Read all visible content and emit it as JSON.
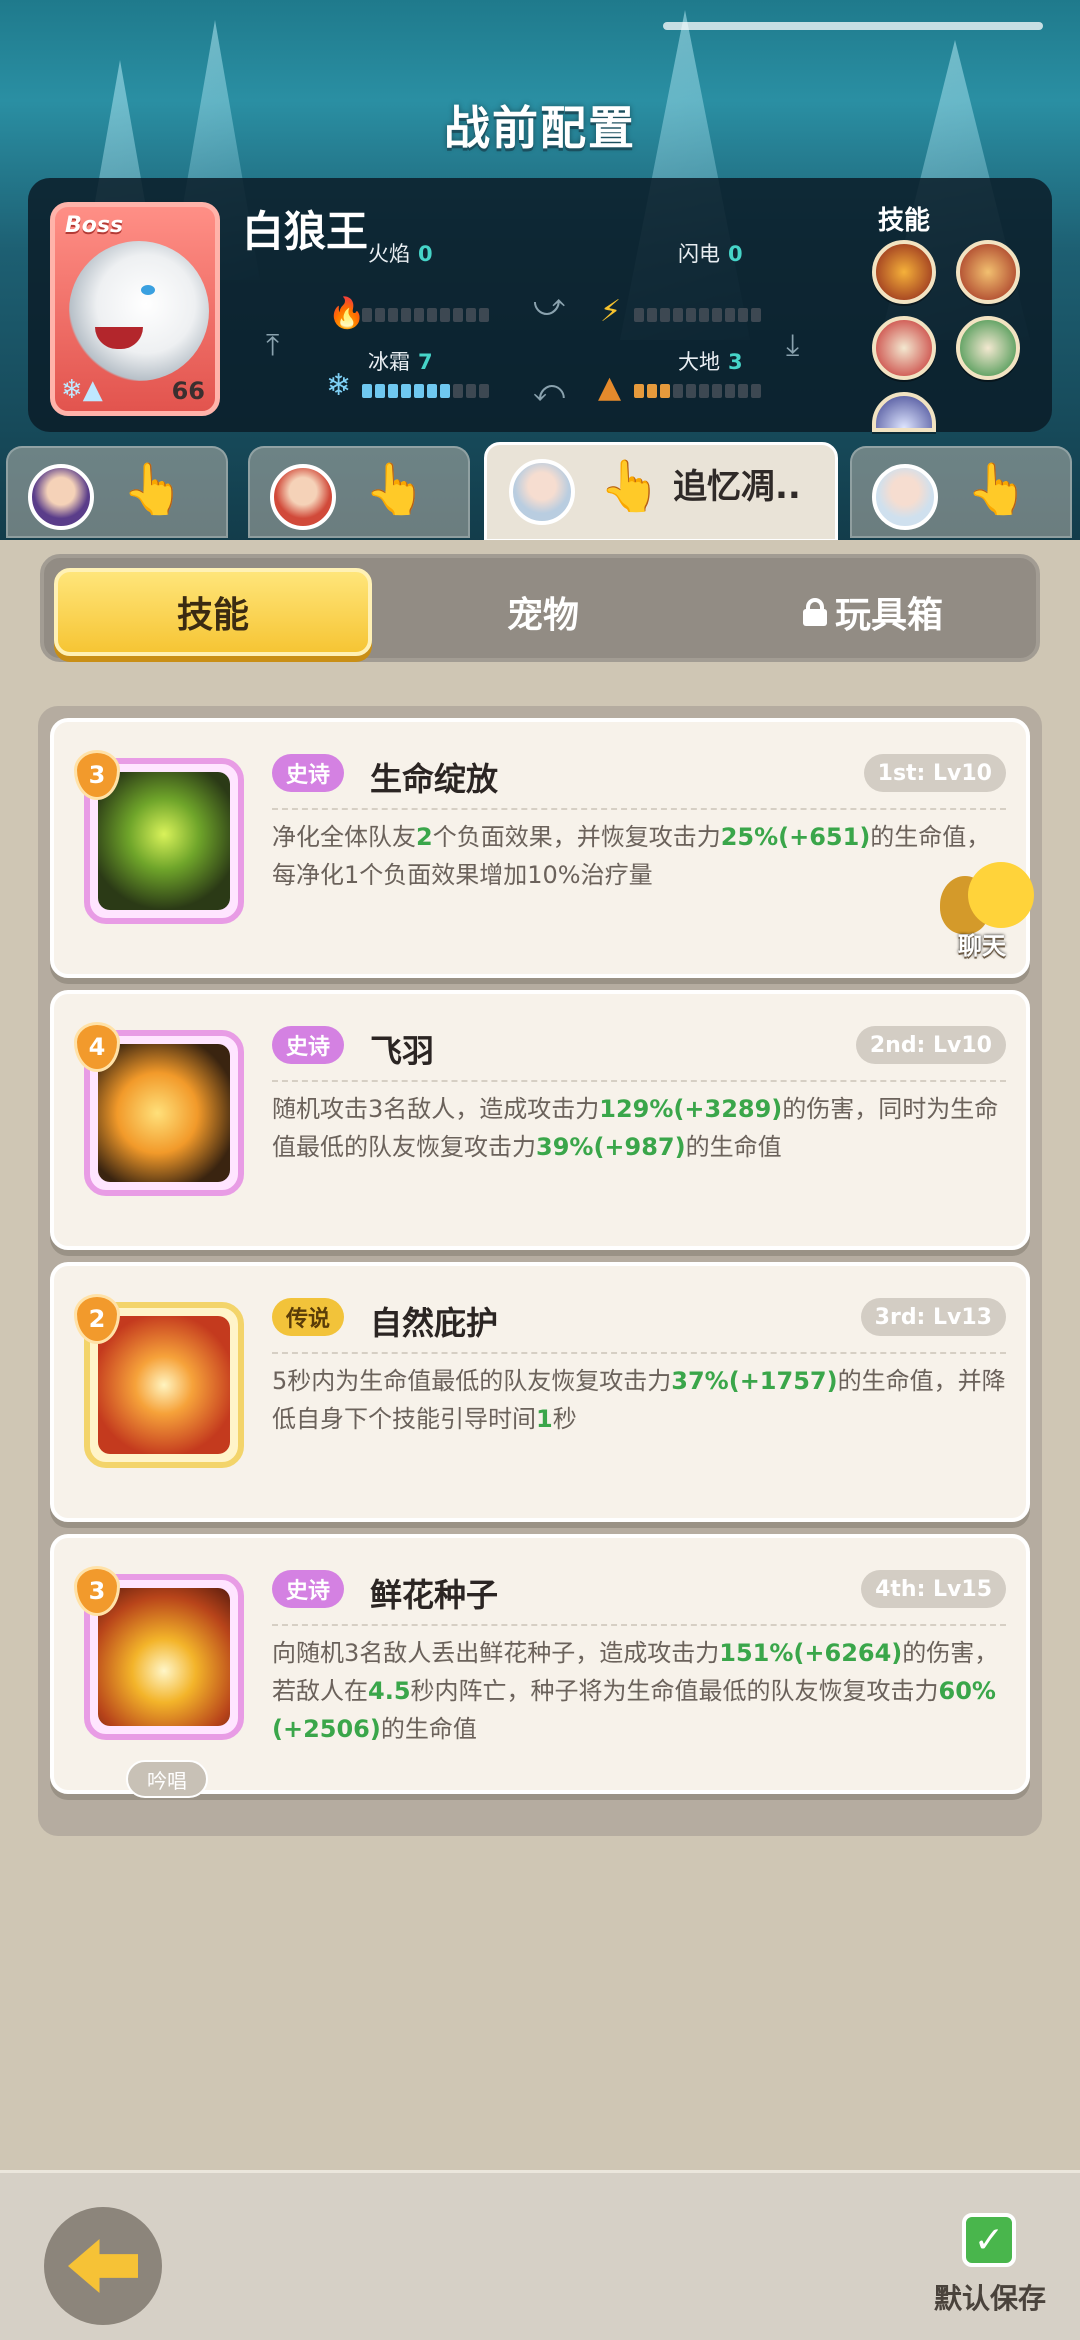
{
  "screen": {
    "title": "战前配置"
  },
  "boss": {
    "tag": "Boss",
    "name": "白狼王",
    "level": "66",
    "stats": {
      "fire": {
        "label": "火焰",
        "value": "0",
        "level_fraction": 0
      },
      "lightning": {
        "label": "闪电",
        "value": "0",
        "level_fraction": 0
      },
      "frost": {
        "label": "冰霜",
        "value": "7",
        "level_fraction": 0.7
      },
      "earth": {
        "label": "大地",
        "value": "3",
        "level_fraction": 0.3
      }
    },
    "skills_label": "技能",
    "skill_icons": [
      "claw-fire-icon",
      "claw-slash-icon",
      "red-beast-icon",
      "green-beast-icon",
      "moon-icon"
    ]
  },
  "hero_tabs": [
    {
      "avatar": "hero-purple-hair-avatar",
      "selected": false,
      "name": ""
    },
    {
      "avatar": "hero-red-hair-avatar",
      "selected": false,
      "name": ""
    },
    {
      "avatar": "hero-silver-hair-avatar",
      "selected": true,
      "name": "追忆凋.."
    },
    {
      "avatar": "hero-white-hair-avatar",
      "selected": false,
      "name": ""
    }
  ],
  "segment": {
    "skills": "技能",
    "pets": "宠物",
    "toybox": "玩具箱",
    "active": "skills"
  },
  "skills": [
    {
      "badge": "3",
      "rarity": "史诗",
      "name": "生命绽放",
      "slot": "1st: Lv10",
      "desc_parts": [
        "净化全体队友",
        "2",
        "个负面效果，并恢复攻击力",
        "25%(+651)",
        "的生命值，每净化1个负面效果增加10%治疗量"
      ],
      "icon": "heart-flower-icon"
    },
    {
      "badge": "4",
      "rarity": "史诗",
      "name": "飞羽",
      "slot": "2nd: Lv10",
      "desc_parts": [
        "随机攻击3名敌人，造成攻击力",
        "129%(+3289)",
        "的伤害，同时为生命值最低的队友恢复攻击力",
        "39%(+987)",
        "的生命值"
      ],
      "icon": "feathers-icon"
    },
    {
      "badge": "2",
      "rarity": "传说",
      "name": "自然庇护",
      "slot": "3rd: Lv13",
      "desc_parts": [
        "5秒内为生命值最低的队友恢复攻击力",
        "37%(+1757)",
        "的生命值，并降低自身下个技能引导时间",
        "1",
        "秒"
      ],
      "icon": "healing-cross-icon"
    },
    {
      "badge": "3",
      "rarity": "史诗",
      "name": "鲜花种子",
      "slot": "4th: Lv15",
      "desc_parts": [
        "向随机3名敌人丢出鲜花种子，造成攻击力",
        "151%(+6264)",
        "的伤害，若敌人在",
        "4.5",
        "秒内阵亡，种子将为生命值最低的队友恢复攻击力",
        "60%(+2506)",
        "的生命值"
      ],
      "chant": "吟唱",
      "icon": "glowing-seed-icon"
    }
  ],
  "chat": {
    "label": "聊天"
  },
  "bottom": {
    "save_label": "默认保存",
    "save_checked": true
  },
  "colors": {
    "accent_yellow": "#f6c534",
    "epic_purple": "#d481e2",
    "legend_gold": "#f2c33a",
    "value_green": "#3aa64a"
  }
}
